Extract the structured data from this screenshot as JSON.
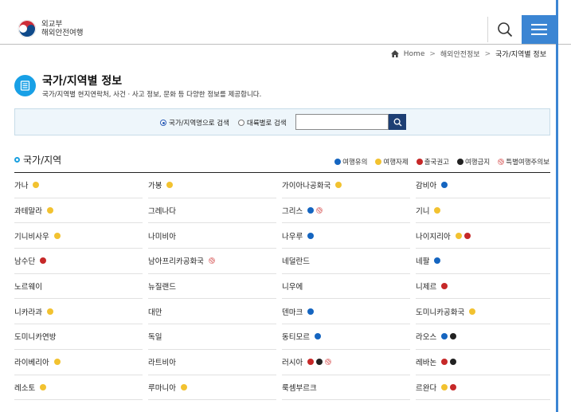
{
  "header": {
    "logo_line1": "외교부",
    "logo_line2": "해외안전여행"
  },
  "breadcrumb": {
    "home": "Home",
    "level1": "해외안전정보",
    "current": "국가/지역별 정보",
    "sep": ">"
  },
  "page": {
    "title": "국가/지역별 정보",
    "subtitle": "국가/지역별 현지연락처, 사건 · 사고 정보, 문화 등 다양한 정보를 제공합니다."
  },
  "search": {
    "option_by_country": "국가/지역명으로 검색",
    "option_by_continent": "대륙별로 검색",
    "value": "",
    "placeholder": ""
  },
  "section": {
    "title": "국가/지역"
  },
  "colors": {
    "caution": "#1565c0",
    "restraint": "#f2c230",
    "departure": "#c62828",
    "banned": "#222222",
    "special": "#e38f8f"
  },
  "legend": [
    {
      "label": "여행유의",
      "type": "caution"
    },
    {
      "label": "여행자제",
      "type": "restraint"
    },
    {
      "label": "출국권고",
      "type": "departure"
    },
    {
      "label": "여행금지",
      "type": "banned"
    },
    {
      "label": "특별여행주의보",
      "type": "special"
    }
  ],
  "countries": [
    {
      "name": "가나",
      "levels": [
        "restraint"
      ]
    },
    {
      "name": "가봉",
      "levels": [
        "restraint"
      ]
    },
    {
      "name": "가이아나공화국",
      "levels": [
        "restraint"
      ]
    },
    {
      "name": "감비아",
      "levels": [
        "caution"
      ]
    },
    {
      "name": "과테말라",
      "levels": [
        "restraint"
      ]
    },
    {
      "name": "그레나다",
      "levels": []
    },
    {
      "name": "그리스",
      "levels": [
        "caution",
        "special"
      ]
    },
    {
      "name": "기니",
      "levels": [
        "restraint"
      ]
    },
    {
      "name": "기니비사우",
      "levels": [
        "restraint"
      ]
    },
    {
      "name": "나미비아",
      "levels": []
    },
    {
      "name": "나우루",
      "levels": [
        "caution"
      ]
    },
    {
      "name": "나이지리아",
      "levels": [
        "restraint",
        "departure"
      ]
    },
    {
      "name": "남수단",
      "levels": [
        "departure"
      ]
    },
    {
      "name": "남아프리카공화국",
      "levels": [
        "special"
      ]
    },
    {
      "name": "네덜란드",
      "levels": []
    },
    {
      "name": "네팔",
      "levels": [
        "caution"
      ]
    },
    {
      "name": "노르웨이",
      "levels": []
    },
    {
      "name": "뉴질랜드",
      "levels": []
    },
    {
      "name": "니우에",
      "levels": []
    },
    {
      "name": "니제르",
      "levels": [
        "departure"
      ]
    },
    {
      "name": "니카라과",
      "levels": [
        "restraint"
      ]
    },
    {
      "name": "대만",
      "levels": []
    },
    {
      "name": "덴마크",
      "levels": [
        "caution"
      ]
    },
    {
      "name": "도미니카공화국",
      "levels": [
        "restraint"
      ]
    },
    {
      "name": "도미니카연방",
      "levels": []
    },
    {
      "name": "독일",
      "levels": []
    },
    {
      "name": "동티모르",
      "levels": [
        "caution"
      ]
    },
    {
      "name": "라오스",
      "levels": [
        "caution",
        "banned"
      ]
    },
    {
      "name": "라이베리아",
      "levels": [
        "restraint"
      ]
    },
    {
      "name": "라트비아",
      "levels": []
    },
    {
      "name": "러시아",
      "levels": [
        "departure",
        "banned",
        "special"
      ]
    },
    {
      "name": "레바논",
      "levels": [
        "departure",
        "banned"
      ]
    },
    {
      "name": "레소토",
      "levels": [
        "restraint"
      ]
    },
    {
      "name": "루마니아",
      "levels": [
        "restraint"
      ]
    },
    {
      "name": "룩셈부르크",
      "levels": []
    },
    {
      "name": "르완다",
      "levels": [
        "restraint",
        "departure"
      ]
    }
  ]
}
